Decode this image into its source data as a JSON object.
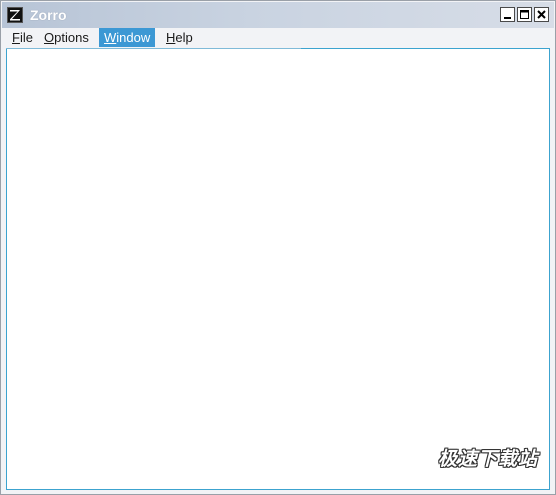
{
  "window": {
    "title": "Zorro",
    "app_icon": "zorro-z-icon",
    "controls": {
      "minimize_icon": "minimize-icon",
      "maximize_icon": "maximize-icon",
      "close_icon": "close-icon"
    }
  },
  "menubar": {
    "items": [
      {
        "label": "File",
        "access_key": "F",
        "rest": "ile"
      },
      {
        "label": "Options",
        "access_key": "O",
        "rest": "ptions"
      },
      {
        "label": "Window",
        "access_key": "W",
        "rest": "indow",
        "active": true
      },
      {
        "label": "Help",
        "access_key": "H",
        "rest": "elp"
      }
    ]
  },
  "watermark": {
    "text": "极速下载站"
  },
  "colors": {
    "titlebar": "#c9d3e1",
    "menu_highlight": "#3c98d4",
    "client_border": "#3ca3cf",
    "client_background": "#ffffff"
  }
}
